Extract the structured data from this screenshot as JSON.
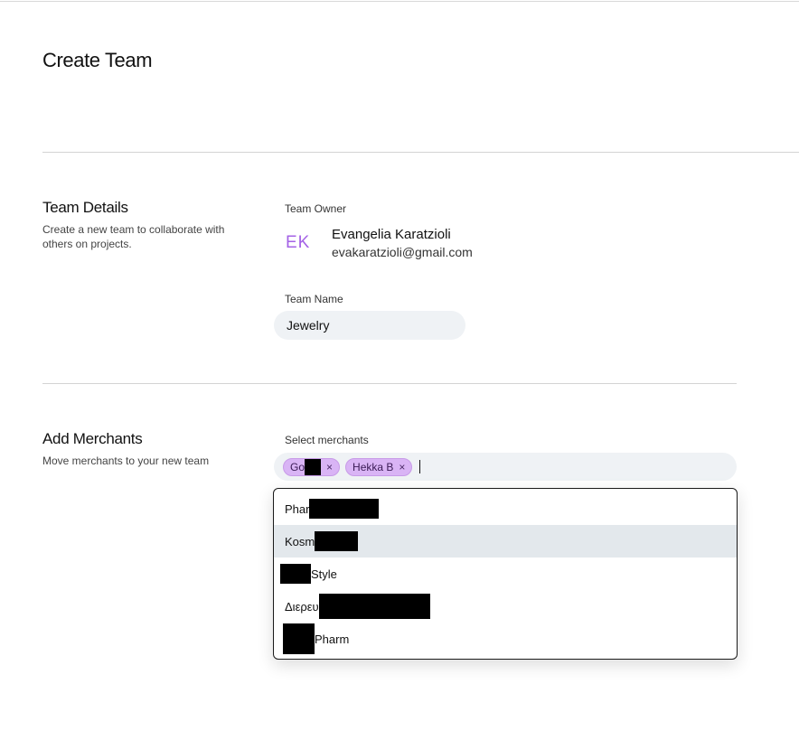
{
  "page": {
    "title": "Create Team"
  },
  "team_details": {
    "title": "Team Details",
    "description": "Create a new team to collaborate with others on projects.",
    "owner_label": "Team Owner",
    "owner": {
      "initials": "EK",
      "name": "Evangelia Karatzioli",
      "email": "evakaratzioli@gmail.com"
    },
    "team_name_label": "Team Name",
    "team_name_value": "Jewelry"
  },
  "add_merchants": {
    "title": "Add Merchants",
    "description": "Move merchants to your new team",
    "select_label": "Select merchants",
    "chips": [
      {
        "label": "Go",
        "remove": "×"
      },
      {
        "label": "Hekka B",
        "remove": "×"
      }
    ],
    "options": [
      {
        "prefix": "Phar",
        "suffix": ""
      },
      {
        "prefix": "Kosm",
        "suffix": ""
      },
      {
        "prefix": "",
        "suffix": "Style"
      },
      {
        "prefix": "Διερευ",
        "suffix": ""
      },
      {
        "prefix": "",
        "suffix": "Pharm"
      }
    ]
  },
  "colors": {
    "avatar_text": "#a463e6",
    "chip_background": "#d9b4f5",
    "input_background": "#eff2f5",
    "option_highlight": "#e3e8ec"
  }
}
